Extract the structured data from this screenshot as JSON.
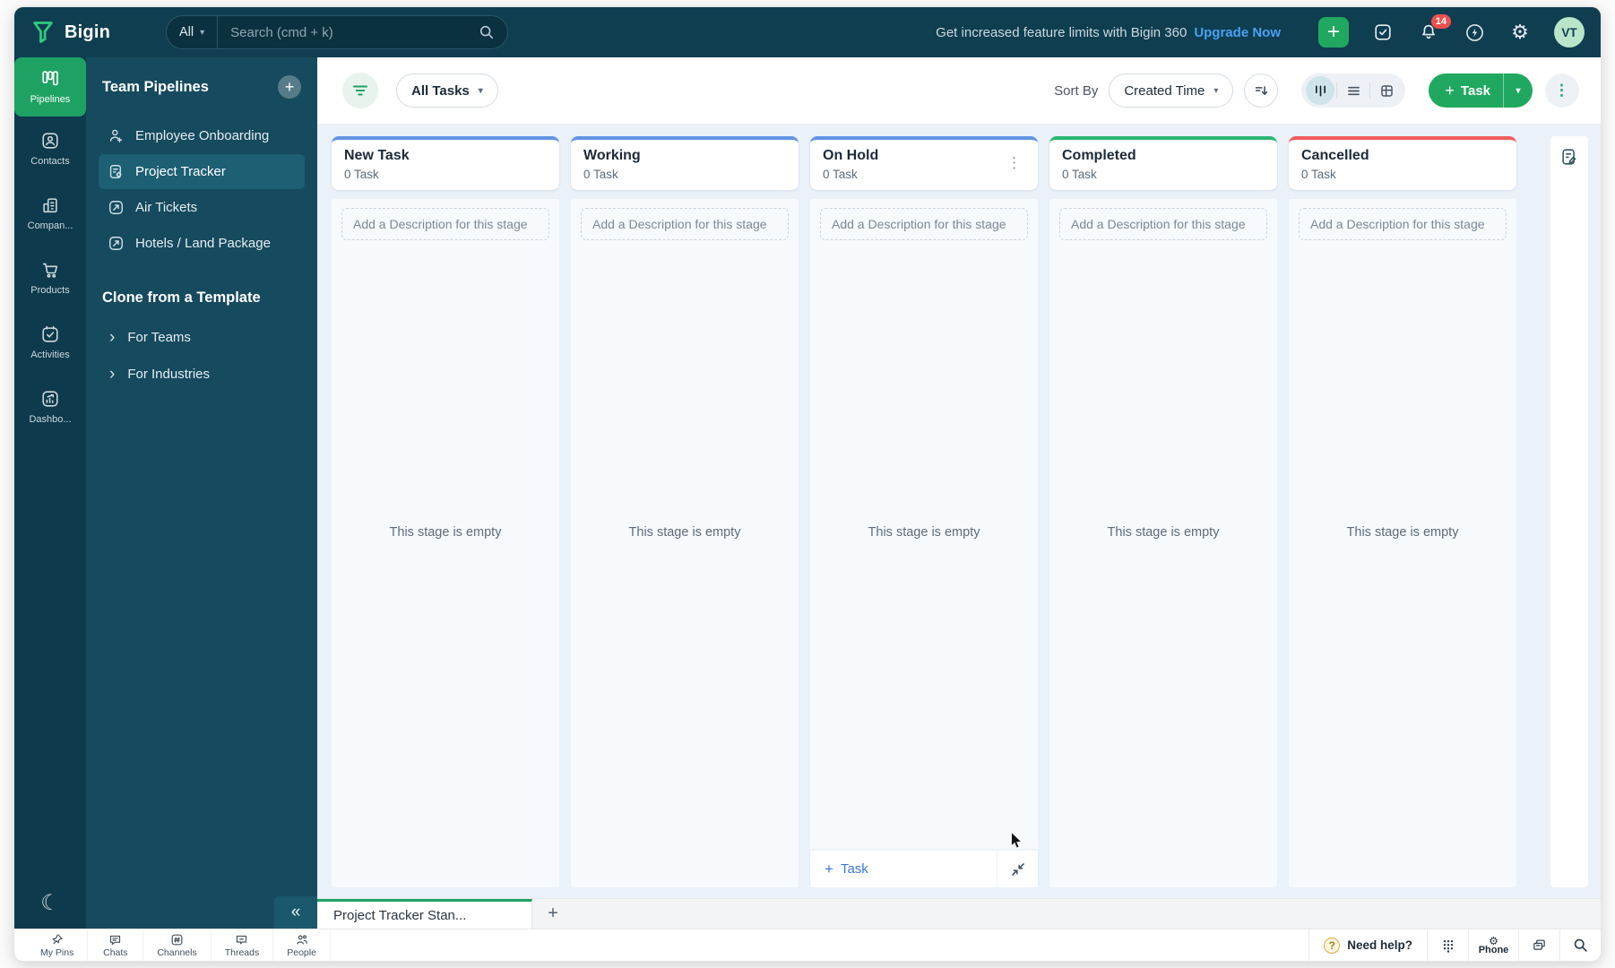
{
  "icons": {
    "plus": "+",
    "gear": "⚙",
    "moon": "☾",
    "chevron_right": "›",
    "collapse_left": "«",
    "caret_down": "▾",
    "dots_vertical": "⋮",
    "question_mark": "?"
  },
  "topbar": {
    "brand": "Bigin",
    "search": {
      "scope": "All",
      "placeholder": "Search (cmd + k)"
    },
    "promo": {
      "text": "Get increased feature limits with Bigin 360",
      "link": "Upgrade Now"
    },
    "notifications_badge": "14",
    "avatar_initials": "VT"
  },
  "left_rail": {
    "items": [
      {
        "label": "Pipelines"
      },
      {
        "label": "Contacts"
      },
      {
        "label": "Compan..."
      },
      {
        "label": "Products"
      },
      {
        "label": "Activities"
      },
      {
        "label": "Dashbo..."
      }
    ]
  },
  "sidebar": {
    "title": "Team Pipelines",
    "pipelines": [
      {
        "label": "Employee Onboarding"
      },
      {
        "label": "Project Tracker"
      },
      {
        "label": "Air Tickets"
      },
      {
        "label": "Hotels / Land Package"
      }
    ],
    "clone_title": "Clone from a Template",
    "clone_items": [
      {
        "label": "For Teams"
      },
      {
        "label": "For Industries"
      }
    ]
  },
  "toolbar": {
    "task_filter": "All Tasks",
    "sort_by_label": "Sort By",
    "sort_value": "Created Time",
    "add_task_label": "Task"
  },
  "board": {
    "columns": [
      {
        "name": "New Task",
        "count": "0 Task",
        "description_placeholder": "Add a Description for this stage",
        "empty_text": "This stage is empty",
        "accent": "#6193e4"
      },
      {
        "name": "Working",
        "count": "0 Task",
        "description_placeholder": "Add a Description for this stage",
        "empty_text": "This stage is empty",
        "accent": "#6193e4"
      },
      {
        "name": "On Hold",
        "count": "0 Task",
        "description_placeholder": "Add a Description for this stage",
        "empty_text": "This stage is empty",
        "accent": "#6193e4",
        "footer_add_label": "Task"
      },
      {
        "name": "Completed",
        "count": "0 Task",
        "description_placeholder": "Add a Description for this stage",
        "empty_text": "This stage is empty",
        "accent": "#2bb673"
      },
      {
        "name": "Cancelled",
        "count": "0 Task",
        "description_placeholder": "Add a Description for this stage",
        "empty_text": "This stage is empty",
        "accent": "#f25c5c"
      }
    ]
  },
  "tabstrip": {
    "active_tab": "Project Tracker Stan..."
  },
  "dock": {
    "items": [
      {
        "label": "My Pins"
      },
      {
        "label": "Chats"
      },
      {
        "label": "Channels"
      },
      {
        "label": "Threads"
      },
      {
        "label": "People"
      }
    ],
    "help_label": "Need help?",
    "phone_label": "Phone"
  },
  "colors": {
    "accent_green": "#1ea263",
    "topbar_teal": "#0f3e51",
    "link_blue": "#4aa0f2",
    "badge_red": "#f04f4f",
    "stage_blue": "#6193e4",
    "stage_green": "#2bb673",
    "stage_red": "#f25c5c"
  }
}
